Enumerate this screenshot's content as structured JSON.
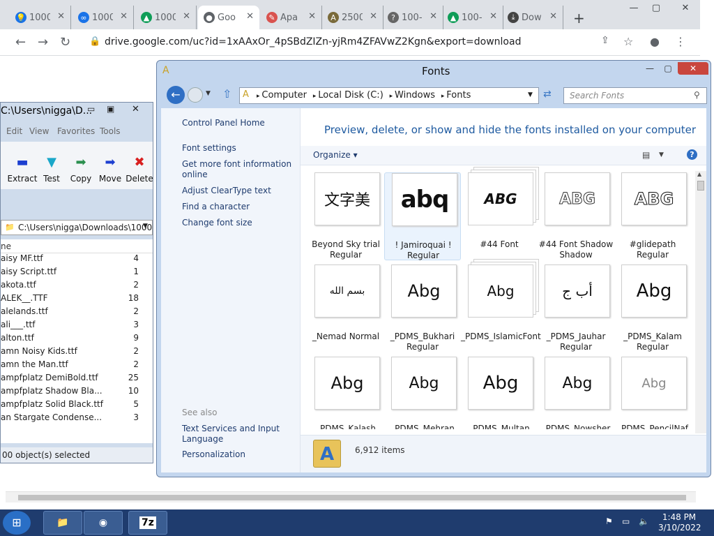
{
  "chrome": {
    "tabs": [
      {
        "label": "1000",
        "fav_color": "#1a73e8",
        "fav": "bulb-icon"
      },
      {
        "label": "1000",
        "fav_color": "#1a73e8",
        "fav": "link-icon"
      },
      {
        "label": "1000",
        "fav_color": "#0f9d58",
        "fav": "google-drive-icon"
      },
      {
        "label": "Goo",
        "fav_color": "#5f6368",
        "fav": "globe-icon"
      },
      {
        "label": "Apa",
        "fav_color": "#d9534f",
        "fav": "feather-icon"
      },
      {
        "label": "2500",
        "fav_color": "#7a6a3a",
        "fav": "font-icon"
      },
      {
        "label": "100-",
        "fav_color": "#666666",
        "fav": "question-icon"
      },
      {
        "label": "100-",
        "fav_color": "#0f9d58",
        "fav": "google-drive-icon"
      },
      {
        "label": "Dow",
        "fav_color": "#444444",
        "fav": "download-icon"
      }
    ],
    "active_tab": 3,
    "url": "drive.google.com/uc?id=1xAAxOr_4pSBdZIZn-yjRm4ZFAVwZ2Kgn&export=download"
  },
  "zip": {
    "title": "C:\\Users\\nigga\\D...",
    "menu": [
      "Edit",
      "View",
      "Favorites",
      "Tools"
    ],
    "tools": [
      {
        "label": "Extract",
        "icon": "extract-icon",
        "color": "#1c3fd0"
      },
      {
        "label": "Test",
        "icon": "test-icon",
        "color": "#1aa7c9"
      },
      {
        "label": "Copy",
        "icon": "copy-icon",
        "color": "#2a8f4e"
      },
      {
        "label": "Move",
        "icon": "move-icon",
        "color": "#1c3fd0"
      },
      {
        "label": "Delete",
        "icon": "delete-icon",
        "color": "#d81f1f"
      }
    ],
    "path": "C:\\Users\\nigga\\Downloads\\1000",
    "column": "ne",
    "rows": [
      {
        "name": "aisy MF.ttf",
        "size": "4"
      },
      {
        "name": "aisy Script.ttf",
        "size": "1"
      },
      {
        "name": "akota.ttf",
        "size": "2"
      },
      {
        "name": "ALEK__.TTF",
        "size": "18"
      },
      {
        "name": "alelands.ttf",
        "size": "2"
      },
      {
        "name": "ali___.ttf",
        "size": "3"
      },
      {
        "name": "alton.ttf",
        "size": "9"
      },
      {
        "name": "amn Noisy Kids.ttf",
        "size": "2"
      },
      {
        "name": "amn the Man.ttf",
        "size": "2"
      },
      {
        "name": "ampfplatz DemiBold.ttf",
        "size": "25"
      },
      {
        "name": "ampfplatz Shadow Bla...",
        "size": "10"
      },
      {
        "name": "ampfplatz Solid Black.ttf",
        "size": "5"
      },
      {
        "name": "an Stargate Condense...",
        "size": "3"
      }
    ],
    "status": "00 object(s) selected"
  },
  "fonts": {
    "title": "Fonts",
    "breadcrumb": [
      "Computer",
      "Local Disk (C:)",
      "Windows",
      "Fonts"
    ],
    "search_placeholder": "Search Fonts",
    "left_links": [
      "Control Panel Home",
      "Font settings",
      "Get more font information online",
      "Adjust ClearType text",
      "Find a character",
      "Change font size"
    ],
    "see_also_label": "See also",
    "see_also": [
      "Text Services and Input Language",
      "Personalization"
    ],
    "heading": "Preview, delete, or show and hide the fonts installed on your computer",
    "organize": "Organize",
    "items": [
      {
        "glyph": "文字美",
        "caption": "Beyond Sky trial Regular",
        "stack": false
      },
      {
        "glyph": "abq",
        "caption": "! Jamiroquai ! Regular",
        "stack": false
      },
      {
        "glyph": "ABG",
        "caption": "#44 Font",
        "stack": true
      },
      {
        "glyph": "ABG",
        "caption": "#44 Font Shadow Shadow",
        "stack": false
      },
      {
        "glyph": "ABG",
        "caption": "#glidepath Regular",
        "stack": false
      },
      {
        "glyph": "بسم الله",
        "caption": "_Nemad Normal",
        "stack": false
      },
      {
        "glyph": "Abg",
        "caption": "_PDMS_Bukhari Regular",
        "stack": false
      },
      {
        "glyph": "Abg",
        "caption": "_PDMS_IslamicFont",
        "stack": true
      },
      {
        "glyph": "أب ج",
        "caption": "_PDMS_Jauhar Regular",
        "stack": false
      },
      {
        "glyph": "Abg",
        "caption": "_PDMS_Kalam Regular",
        "stack": false
      },
      {
        "glyph": "Abg",
        "caption": "_PDMS_Kalash",
        "stack": false
      },
      {
        "glyph": "Abg",
        "caption": "_PDMS_Mehran",
        "stack": false
      },
      {
        "glyph": "Abg",
        "caption": "_PDMS_Multan",
        "stack": false
      },
      {
        "glyph": "Abg",
        "caption": "_PDMS_Nowsher",
        "stack": false
      },
      {
        "glyph": "Abg",
        "caption": "_PDMS_PencilNaf",
        "stack": false
      }
    ],
    "count": "6,912 items"
  },
  "taskbar": {
    "items": [
      {
        "label": "file-explorer-icon"
      },
      {
        "label": "chrome-icon"
      },
      {
        "label": "7z"
      }
    ],
    "time": "1:48 PM",
    "date": "3/10/2022"
  }
}
